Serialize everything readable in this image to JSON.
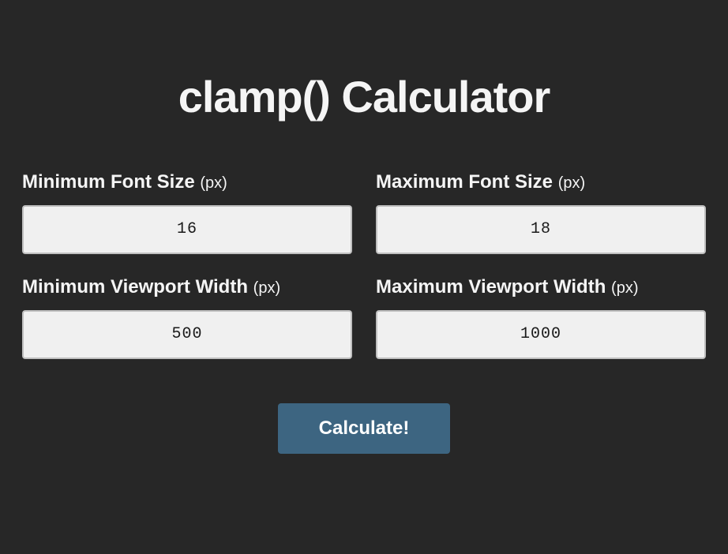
{
  "title": "clamp() Calculator",
  "fields": {
    "min_font": {
      "label": "Minimum Font Size",
      "unit": "(px)",
      "value": "16"
    },
    "max_font": {
      "label": "Maximum Font Size",
      "unit": "(px)",
      "value": "18"
    },
    "min_vw": {
      "label": "Minimum Viewport Width",
      "unit": "(px)",
      "value": "500"
    },
    "max_vw": {
      "label": "Maximum Viewport Width",
      "unit": "(px)",
      "value": "1000"
    }
  },
  "button": {
    "calculate": "Calculate!"
  }
}
